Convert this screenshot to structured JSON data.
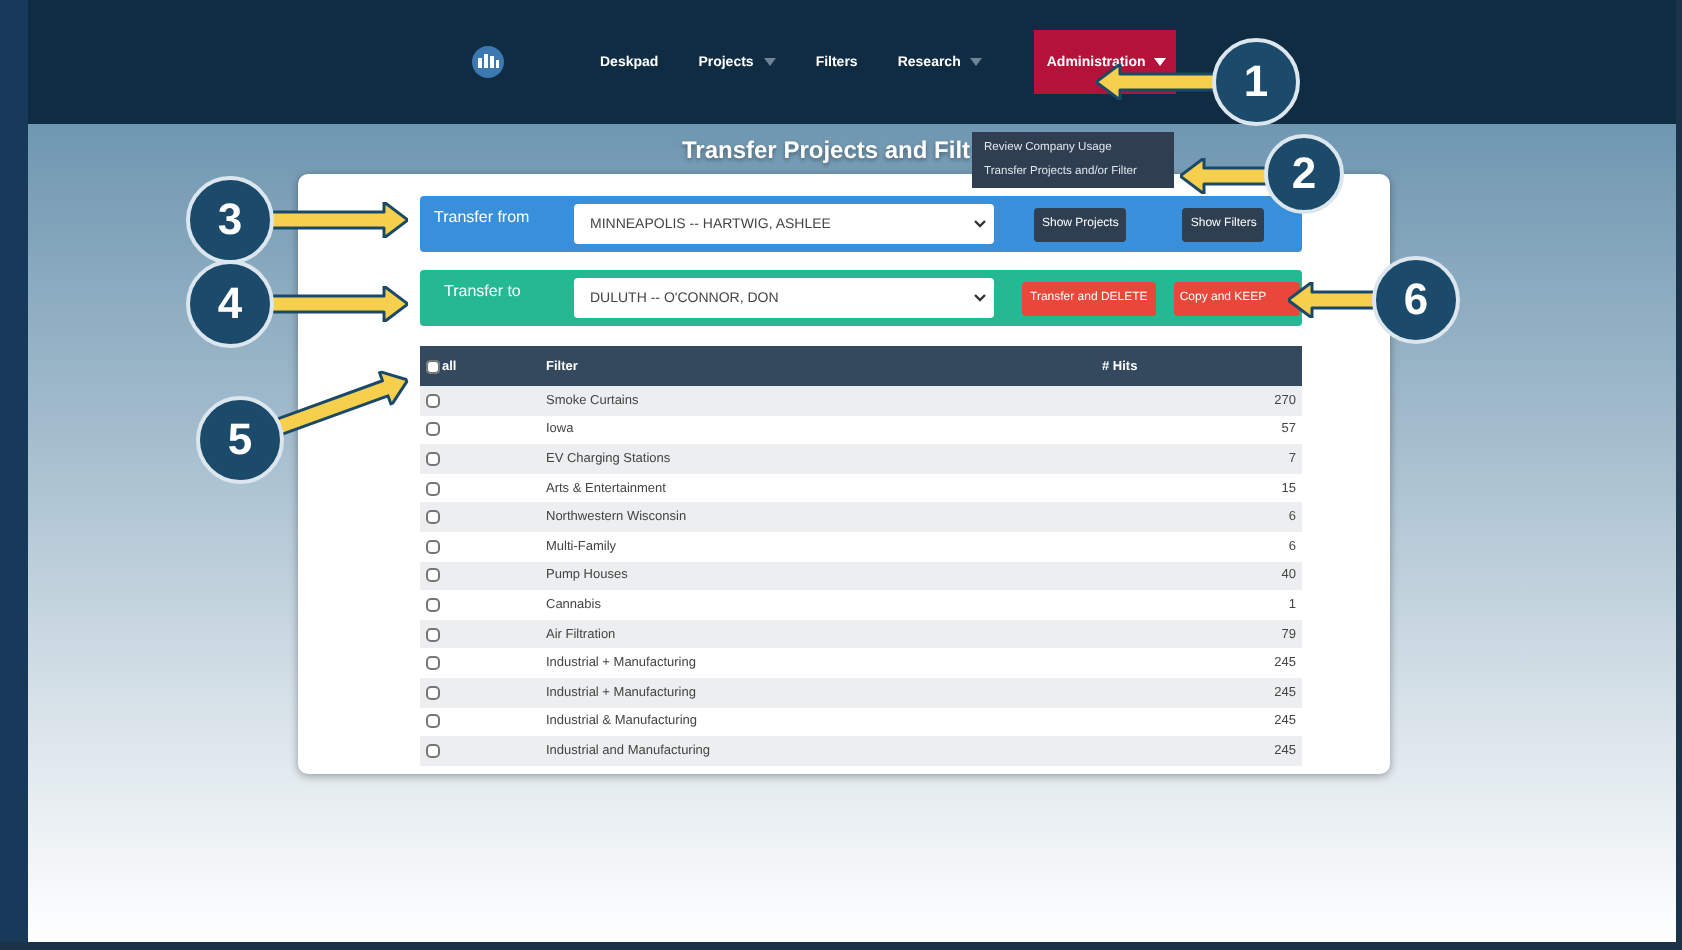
{
  "nav": {
    "items": [
      {
        "label": "Deskpad",
        "kind": "link",
        "selected": false
      },
      {
        "label": "Projects",
        "kind": "dropdown",
        "selected": false
      },
      {
        "label": "Filters",
        "kind": "link",
        "selected": false
      },
      {
        "label": "Research",
        "kind": "dropdown",
        "selected": false
      },
      {
        "label": "Administration",
        "kind": "dropdown",
        "selected": true
      }
    ]
  },
  "admin_menu": [
    "Review Company Usage",
    "Transfer Projects and/or Filter"
  ],
  "title": "Transfer Projects and Filt",
  "transfer_from": {
    "label": "Transfer from",
    "value": "MINNEAPOLIS -- HARTWIG, ASHLEE",
    "buttons": [
      "Show Projects",
      "Show Filters"
    ]
  },
  "transfer_to": {
    "label": "Transfer to",
    "value": "DULUTH -- O'CONNOR, DON",
    "buttons": [
      "Transfer and DELETE",
      "Copy and KEEP"
    ]
  },
  "table": {
    "select_all": {
      "label": "all",
      "checked": false
    },
    "columns": [
      "Filter",
      "# Hits"
    ],
    "rows": [
      {
        "filter": "Smoke Curtains",
        "hits": "270",
        "checked": false
      },
      {
        "filter": "Iowa",
        "hits": "57",
        "checked": false
      },
      {
        "filter": "EV Charging Stations",
        "hits": "7",
        "checked": false
      },
      {
        "filter": "Arts & Entertainment",
        "hits": "15",
        "checked": false
      },
      {
        "filter": "Northwestern Wisconsin",
        "hits": "6",
        "checked": false
      },
      {
        "filter": "Multi-Family",
        "hits": "6",
        "checked": false
      },
      {
        "filter": "Pump Houses",
        "hits": "40",
        "checked": false
      },
      {
        "filter": "Cannabis",
        "hits": "1",
        "checked": false
      },
      {
        "filter": "Air Filtration",
        "hits": "79",
        "checked": false
      },
      {
        "filter": "Industrial + Manufacturing",
        "hits": "245",
        "checked": false
      },
      {
        "filter": "Industrial + Manufacturing",
        "hits": "245",
        "checked": false
      },
      {
        "filter": "Industrial & Manufacturing",
        "hits": "245",
        "checked": false
      },
      {
        "filter": "Industrial and Manufacturing",
        "hits": "245",
        "checked": false
      }
    ]
  },
  "callouts": [
    "1",
    "2",
    "3",
    "4",
    "5",
    "6"
  ]
}
